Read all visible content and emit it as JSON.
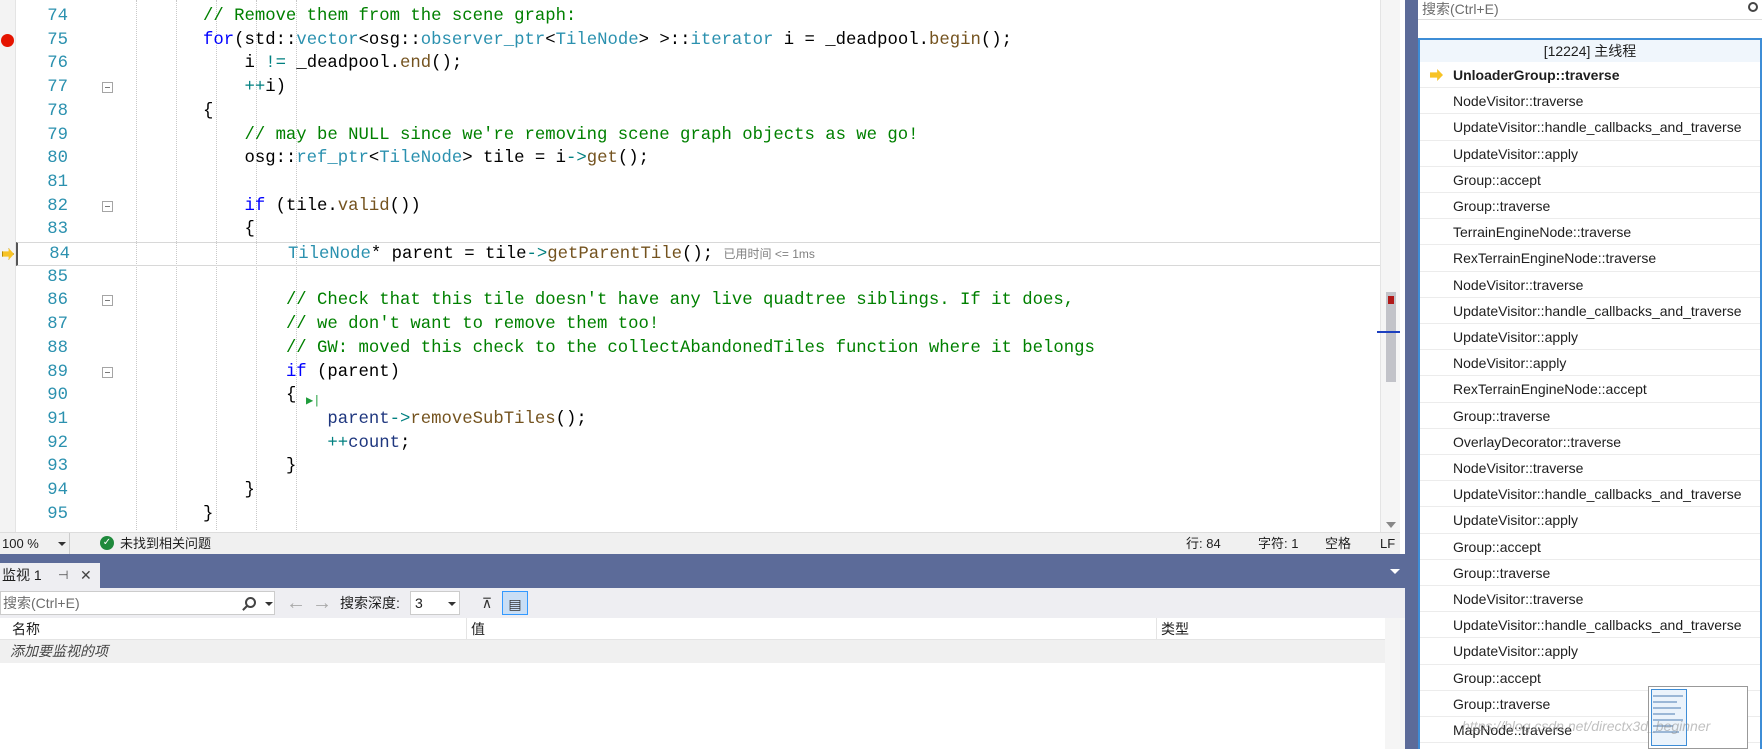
{
  "code_lines": [
    {
      "n": "74",
      "fold": false,
      "bp": false,
      "ip": false,
      "html_indent": "        ",
      "parts": [
        {
          "c": "c",
          "t": "// Remove them from the scene graph:"
        }
      ]
    },
    {
      "n": "75",
      "fold": false,
      "bp": true,
      "ip": false,
      "html_indent": "        ",
      "parts": [
        {
          "c": "k",
          "t": "for"
        },
        {
          "c": "",
          "t": "(std::"
        },
        {
          "c": "t",
          "t": "vector"
        },
        {
          "c": "",
          "t": "<osg::"
        },
        {
          "c": "t",
          "t": "observer_ptr"
        },
        {
          "c": "",
          "t": "<"
        },
        {
          "c": "t",
          "t": "TileNode"
        },
        {
          "c": "",
          "t": "> >::"
        },
        {
          "c": "t",
          "t": "iterator"
        },
        {
          "c": "",
          "t": " i = _deadpool."
        },
        {
          "c": "f",
          "t": "begin"
        },
        {
          "c": "",
          "t": "();"
        }
      ]
    },
    {
      "n": "76",
      "fold": false,
      "bp": false,
      "ip": false,
      "html_indent": "            ",
      "parts": [
        {
          "c": "",
          "t": "i "
        },
        {
          "c": "o",
          "t": "!="
        },
        {
          "c": "",
          "t": " _deadpool."
        },
        {
          "c": "f",
          "t": "end"
        },
        {
          "c": "",
          "t": "();"
        }
      ]
    },
    {
      "n": "77",
      "fold": true,
      "bp": false,
      "ip": false,
      "html_indent": "            ",
      "parts": [
        {
          "c": "o",
          "t": "++"
        },
        {
          "c": "",
          "t": "i)"
        }
      ]
    },
    {
      "n": "78",
      "fold": false,
      "bp": false,
      "ip": false,
      "html_indent": "        ",
      "parts": [
        {
          "c": "",
          "t": "{"
        }
      ]
    },
    {
      "n": "79",
      "fold": false,
      "bp": false,
      "ip": false,
      "html_indent": "            ",
      "parts": [
        {
          "c": "c",
          "t": "// may be NULL since we're removing scene graph objects as we go!"
        }
      ]
    },
    {
      "n": "80",
      "fold": false,
      "bp": false,
      "ip": false,
      "html_indent": "            ",
      "parts": [
        {
          "c": "",
          "t": "osg::"
        },
        {
          "c": "t",
          "t": "ref_ptr"
        },
        {
          "c": "",
          "t": "<"
        },
        {
          "c": "t",
          "t": "TileNode"
        },
        {
          "c": "",
          "t": "> tile = i"
        },
        {
          "c": "o",
          "t": "->"
        },
        {
          "c": "f",
          "t": "get"
        },
        {
          "c": "",
          "t": "();"
        }
      ]
    },
    {
      "n": "81",
      "fold": false,
      "bp": false,
      "ip": false,
      "html_indent": "",
      "parts": []
    },
    {
      "n": "82",
      "fold": true,
      "bp": false,
      "ip": false,
      "html_indent": "            ",
      "parts": [
        {
          "c": "k",
          "t": "if"
        },
        {
          "c": "",
          "t": " (tile."
        },
        {
          "c": "f",
          "t": "valid"
        },
        {
          "c": "",
          "t": "())"
        }
      ]
    },
    {
      "n": "83",
      "fold": false,
      "bp": false,
      "ip": false,
      "html_indent": "            ",
      "parts": [
        {
          "c": "",
          "t": "{"
        }
      ]
    },
    {
      "n": "84",
      "fold": false,
      "bp": false,
      "ip": true,
      "html_indent": "                ",
      "parts": [
        {
          "c": "t",
          "t": "TileNode"
        },
        {
          "c": "",
          "t": "* parent = tile"
        },
        {
          "c": "o",
          "t": "->"
        },
        {
          "c": "f",
          "t": "getParentTile"
        },
        {
          "c": "",
          "t": "(); "
        },
        {
          "c": "g",
          "t": "已用时间 <= 1ms"
        }
      ]
    },
    {
      "n": "85",
      "fold": false,
      "bp": false,
      "ip": false,
      "html_indent": "",
      "parts": []
    },
    {
      "n": "86",
      "fold": true,
      "bp": false,
      "ip": false,
      "html_indent": "                ",
      "parts": [
        {
          "c": "c",
          "t": "// Check that this tile doesn't have any live quadtree siblings. If it does,"
        }
      ]
    },
    {
      "n": "87",
      "fold": false,
      "bp": false,
      "ip": false,
      "html_indent": "                ",
      "parts": [
        {
          "c": "c",
          "t": "// we don't want to remove them too!"
        }
      ]
    },
    {
      "n": "88",
      "fold": false,
      "bp": false,
      "ip": false,
      "html_indent": "                ",
      "parts": [
        {
          "c": "c",
          "t": "// GW: moved this check to the collectAbandonedTiles function where it belongs"
        }
      ]
    },
    {
      "n": "89",
      "fold": true,
      "bp": false,
      "ip": false,
      "html_indent": "                ",
      "parts": [
        {
          "c": "k",
          "t": "if"
        },
        {
          "c": "",
          "t": " (parent)"
        }
      ]
    },
    {
      "n": "90",
      "fold": false,
      "bp": false,
      "ip": false,
      "html_indent": "                ",
      "parts": [
        {
          "c": "",
          "t": "{"
        }
      ]
    },
    {
      "n": "91",
      "fold": false,
      "bp": false,
      "ip": false,
      "html_indent": "                    ",
      "parts": [
        {
          "c": "n",
          "t": "parent"
        },
        {
          "c": "o",
          "t": "->"
        },
        {
          "c": "f",
          "t": "removeSubTiles"
        },
        {
          "c": "",
          "t": "();"
        }
      ]
    },
    {
      "n": "92",
      "fold": false,
      "bp": false,
      "ip": false,
      "html_indent": "                    ",
      "parts": [
        {
          "c": "o",
          "t": "++"
        },
        {
          "c": "n",
          "t": "count"
        },
        {
          "c": "",
          "t": ";"
        }
      ]
    },
    {
      "n": "93",
      "fold": false,
      "bp": false,
      "ip": false,
      "html_indent": "                ",
      "parts": [
        {
          "c": "",
          "t": "}"
        }
      ]
    },
    {
      "n": "94",
      "fold": false,
      "bp": false,
      "ip": false,
      "html_indent": "            ",
      "parts": [
        {
          "c": "",
          "t": "}"
        }
      ]
    },
    {
      "n": "95",
      "fold": false,
      "bp": false,
      "ip": false,
      "html_indent": "        ",
      "parts": [
        {
          "c": "",
          "t": "}"
        }
      ]
    }
  ],
  "editor_status": {
    "zoom": "100 %",
    "issues": "未找到相关问题",
    "line": "行: 84",
    "char": "字符: 1",
    "spaces": "空格",
    "eol": "LF"
  },
  "watch": {
    "tab_label": "监视 1",
    "search_placeholder": "搜索(Ctrl+E)",
    "depth_label": "搜索深度:",
    "depth_value": "3",
    "columns": [
      "名称",
      "值",
      "类型"
    ],
    "add_row_hint": "添加要监视的项"
  },
  "call_stack": {
    "search_placeholder": "搜索(Ctrl+E)",
    "thread_label": "[12224] 主线程",
    "frames": [
      "UnloaderGroup::traverse",
      "NodeVisitor::traverse",
      "UpdateVisitor::handle_callbacks_and_traverse",
      "UpdateVisitor::apply",
      "Group::accept",
      "Group::traverse",
      "TerrainEngineNode::traverse",
      "RexTerrainEngineNode::traverse",
      "NodeVisitor::traverse",
      "UpdateVisitor::handle_callbacks_and_traverse",
      "UpdateVisitor::apply",
      "NodeVisitor::apply",
      "RexTerrainEngineNode::accept",
      "Group::traverse",
      "OverlayDecorator::traverse",
      "NodeVisitor::traverse",
      "UpdateVisitor::handle_callbacks_and_traverse",
      "UpdateVisitor::apply",
      "Group::accept",
      "Group::traverse",
      "NodeVisitor::traverse",
      "UpdateVisitor::handle_callbacks_and_traverse",
      "UpdateVisitor::apply",
      "Group::accept",
      "Group::traverse",
      "MapNode::traverse"
    ]
  },
  "watermark": "https://blog.csdn.net/directx3d_beginner"
}
